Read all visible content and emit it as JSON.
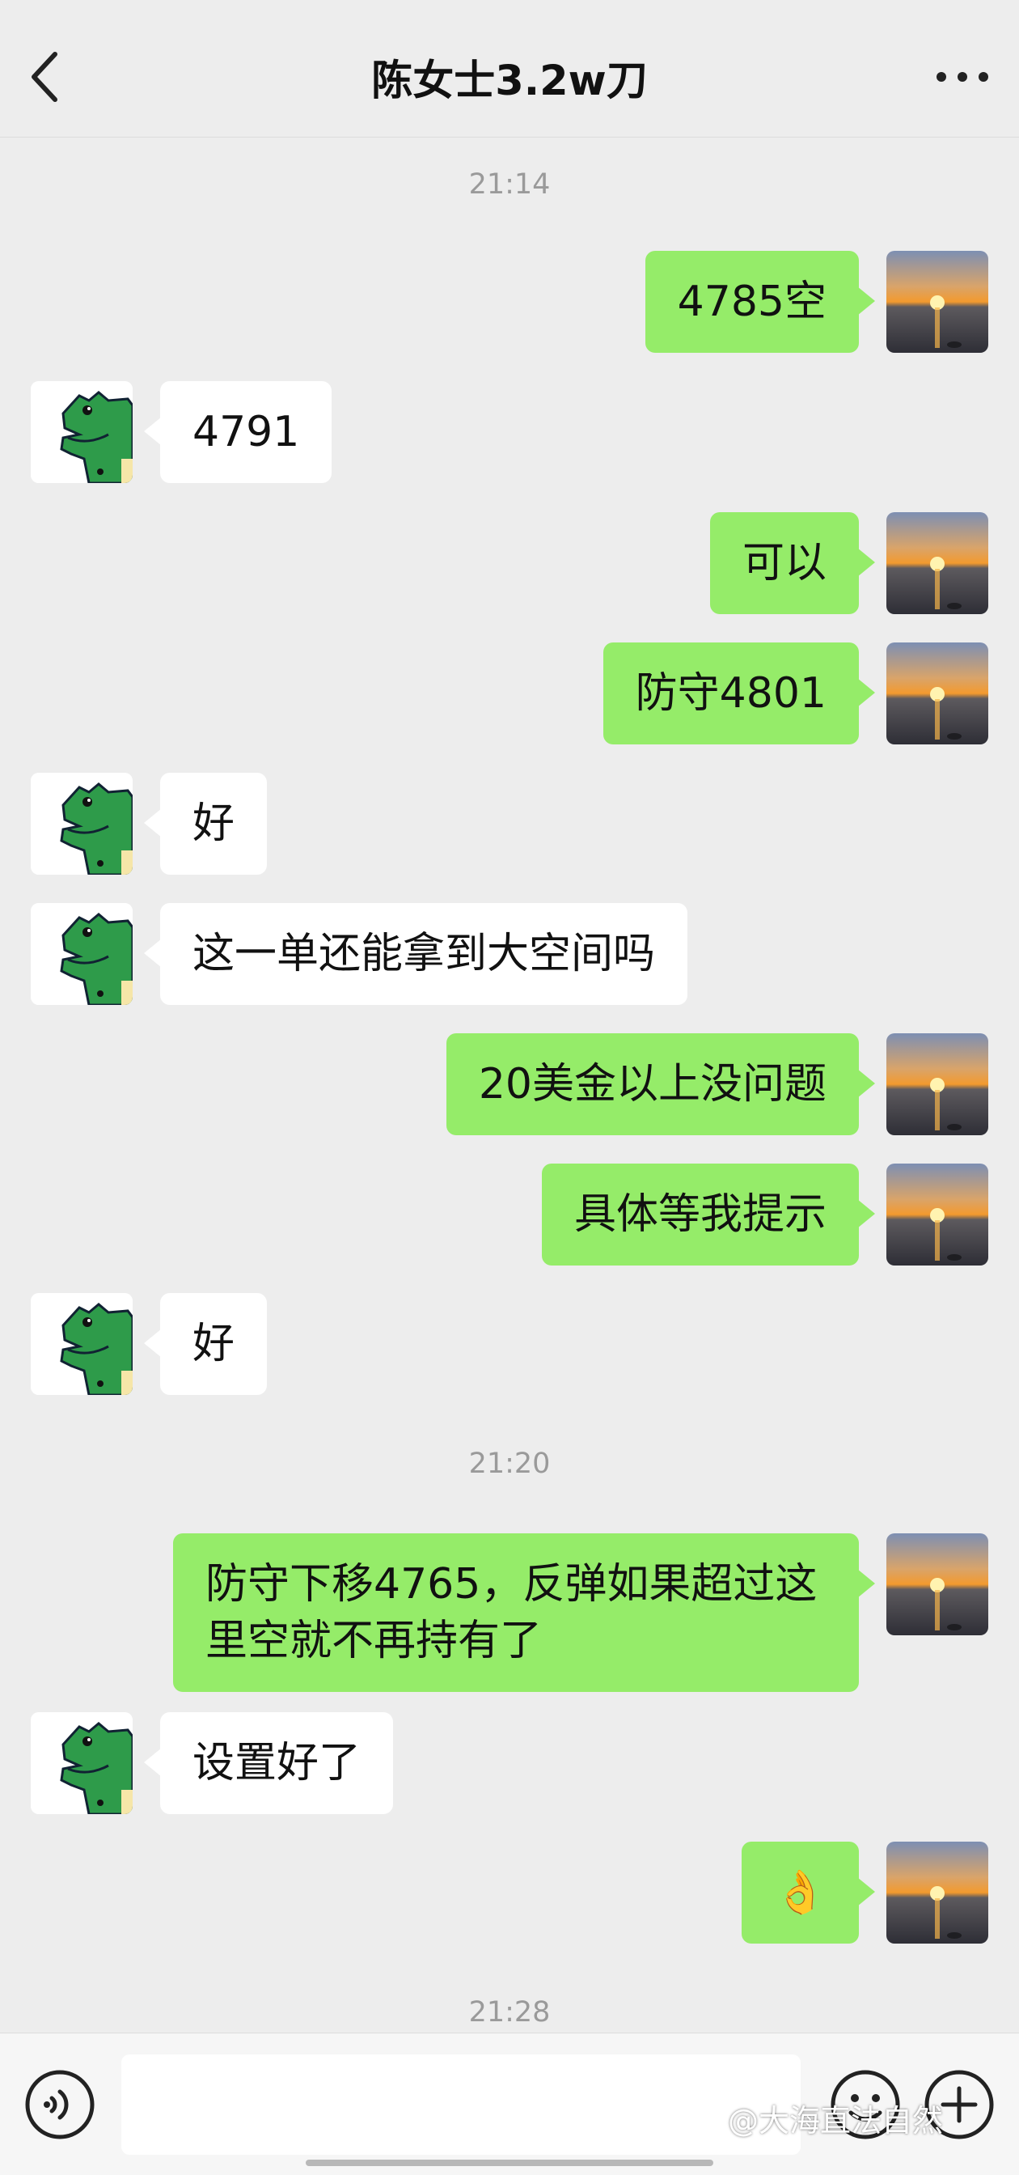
{
  "header": {
    "title": "陈女士3.2w刀"
  },
  "timestamps": [
    "21:14",
    "21:20",
    "21:28"
  ],
  "messages": [
    {
      "side": "out",
      "text": "4785空"
    },
    {
      "side": "in",
      "text": "4791"
    },
    {
      "side": "out",
      "text": "可以"
    },
    {
      "side": "out",
      "text": "防守4801"
    },
    {
      "side": "in",
      "text": "好"
    },
    {
      "side": "in",
      "text": "这一单还能拿到大空间吗"
    },
    {
      "side": "out",
      "text": "20美金以上没问题"
    },
    {
      "side": "out",
      "text": "具体等我提示"
    },
    {
      "side": "in",
      "text": "好"
    },
    {
      "side": "out",
      "text": "防守下移4765，反弹如果超过这里空就不再持有了"
    },
    {
      "side": "in",
      "text": "设置好了"
    },
    {
      "side": "out",
      "text": "👌"
    }
  ],
  "input": {
    "value": ""
  },
  "watermark": "@大海直法自然",
  "colors": {
    "background": "#ededed",
    "outgoing_bubble": "#95ec69",
    "incoming_bubble": "#ffffff",
    "timestamp": "#9a9a9a"
  },
  "icons": {
    "back": "chevron-left-icon",
    "more": "more-dots-icon",
    "voice": "voice-icon",
    "emoji": "emoji-icon",
    "plus": "plus-icon",
    "my_avatar": "sunset-avatar",
    "contact_avatar": "crocodile-avatar"
  }
}
